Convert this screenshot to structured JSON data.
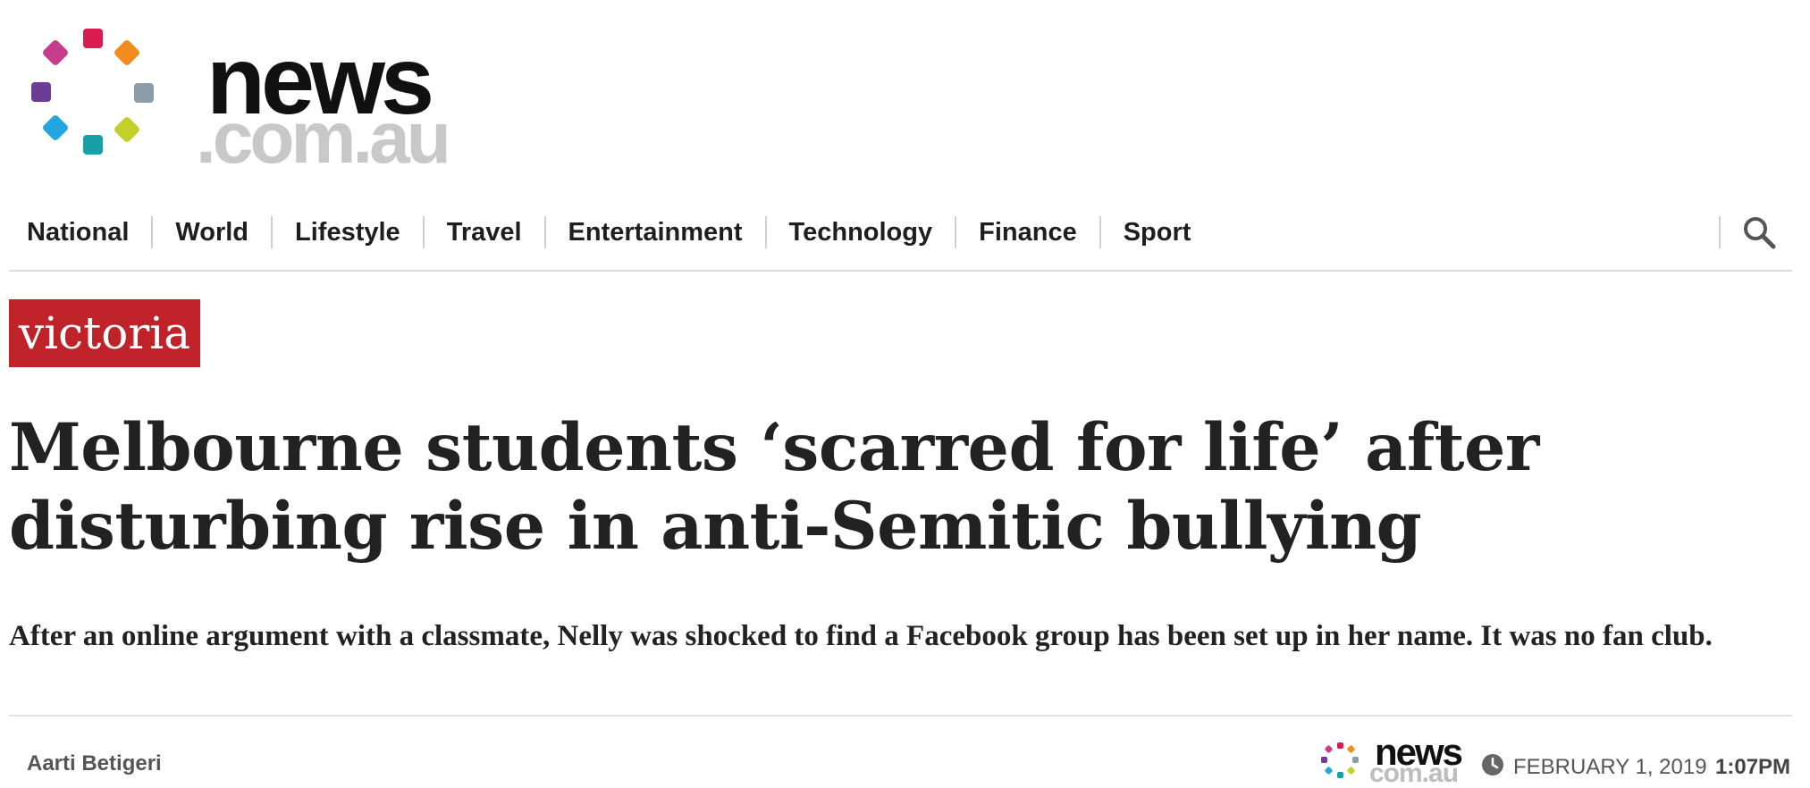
{
  "brand": {
    "wordmark": "news",
    "domain": ".com.au",
    "dot_colors": [
      "#d81b50",
      "#f28c1e",
      "#8c9ca8",
      "#c2d02a",
      "#17a0a8",
      "#22a7e0",
      "#6c3c96",
      "#c73d8e"
    ]
  },
  "nav": {
    "items": [
      "National",
      "World",
      "Lifestyle",
      "Travel",
      "Entertainment",
      "Technology",
      "Finance",
      "Sport"
    ],
    "search_icon": "search-icon"
  },
  "article": {
    "category_tag": "victoria",
    "headline": "Melbourne students ‘scarred for life’ after disturbing rise in anti-Semitic bullying",
    "standfirst": "After an online argument with a classmate, Nelly was shocked to find a Facebook group has been set up in her name. It was no fan club.",
    "author": "Aarti Betigeri",
    "source_logo": {
      "wordmark": "news",
      "domain": "com.au"
    },
    "date": "FEBRUARY 1, 2019",
    "time": "1:07PM"
  },
  "colors": {
    "tag_background": "#c0222a",
    "text": "#222222",
    "muted_text": "#555555"
  }
}
